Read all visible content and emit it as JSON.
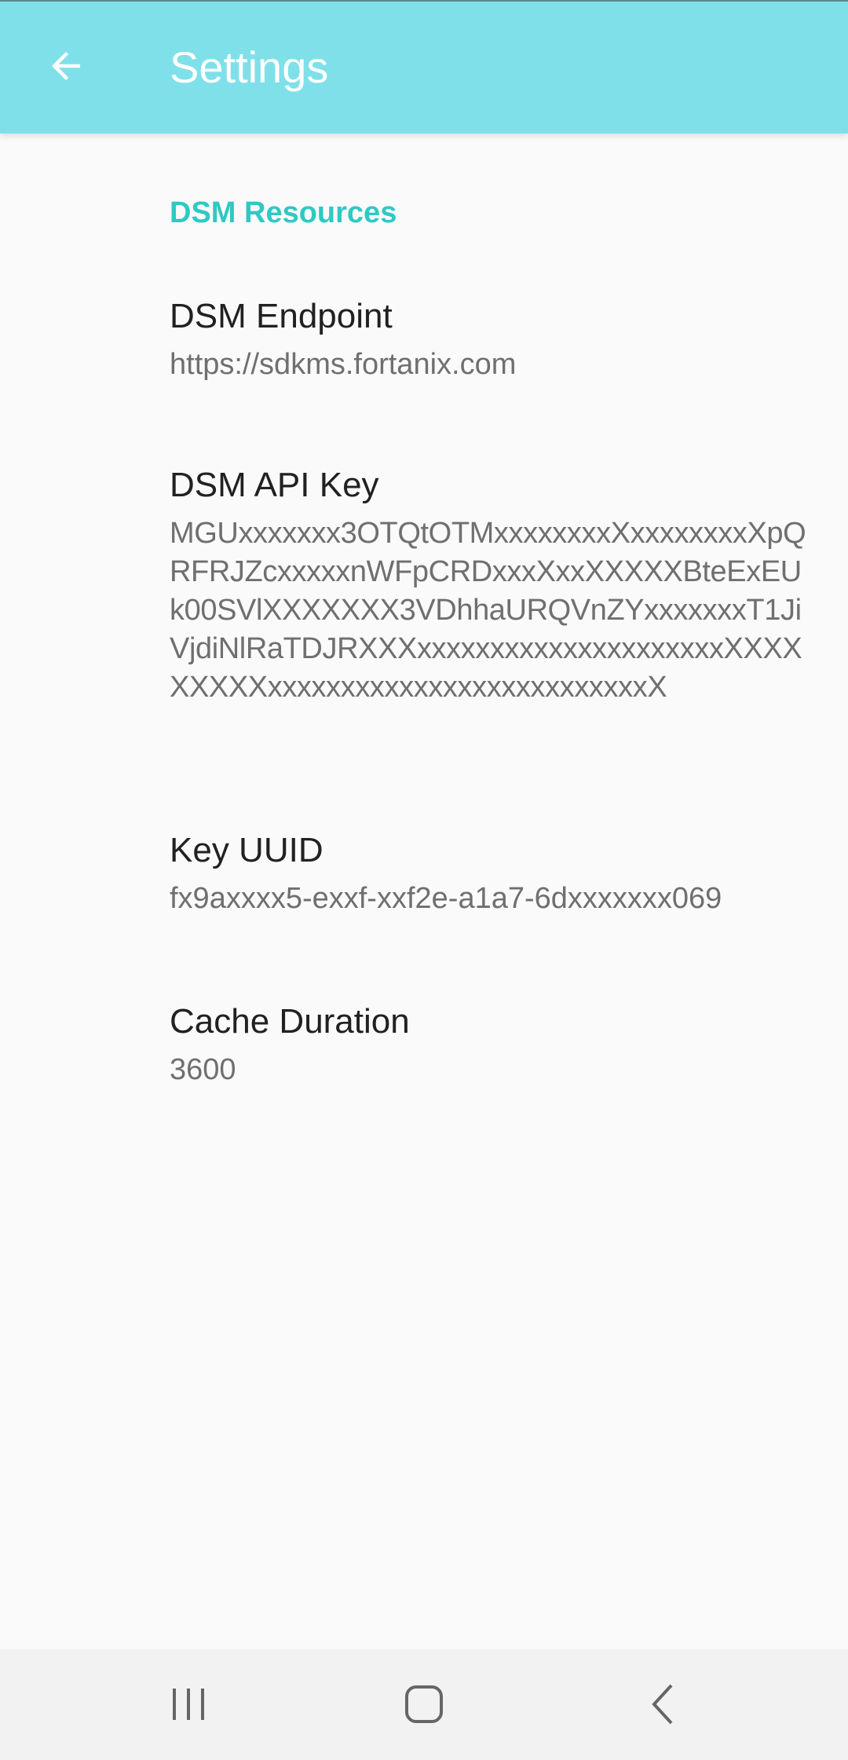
{
  "header": {
    "title": "Settings",
    "back_icon": "arrow-left-icon",
    "background_color": "#7fe0ea"
  },
  "section": {
    "title": "DSM Resources",
    "accent_color": "#2ec9c4"
  },
  "preferences": [
    {
      "title": "DSM Endpoint",
      "summary": "https://sdkms.fortanix.com"
    },
    {
      "title": "DSM API Key",
      "summary": "MGUxxxxxxx3OTQtOTMxxxxxxxxXxxxxxxxxXpQRFRJZcxxxxxnWFpCRDxxxXxxXXXXXBteExEUk00SVlXXXXXXX3VDhhaURQVnZYxxxxxxxT1JiVjdiNlRaTDJRXXXxxxxxxxxxxxxxxxxxxxxxXXXXXXXXXxxxxxxxxxxxxxxxxxxxxxxxxxxX"
    },
    {
      "title": "Key UUID",
      "summary": "fx9axxxx5-exxf-xxf2e-a1a7-6dxxxxxxx069"
    },
    {
      "title": "Cache Duration",
      "summary": "3600"
    }
  ],
  "navbar": {
    "recents_icon": "recent-apps-icon",
    "home_icon": "home-icon",
    "back_icon": "back-chevron-icon"
  }
}
